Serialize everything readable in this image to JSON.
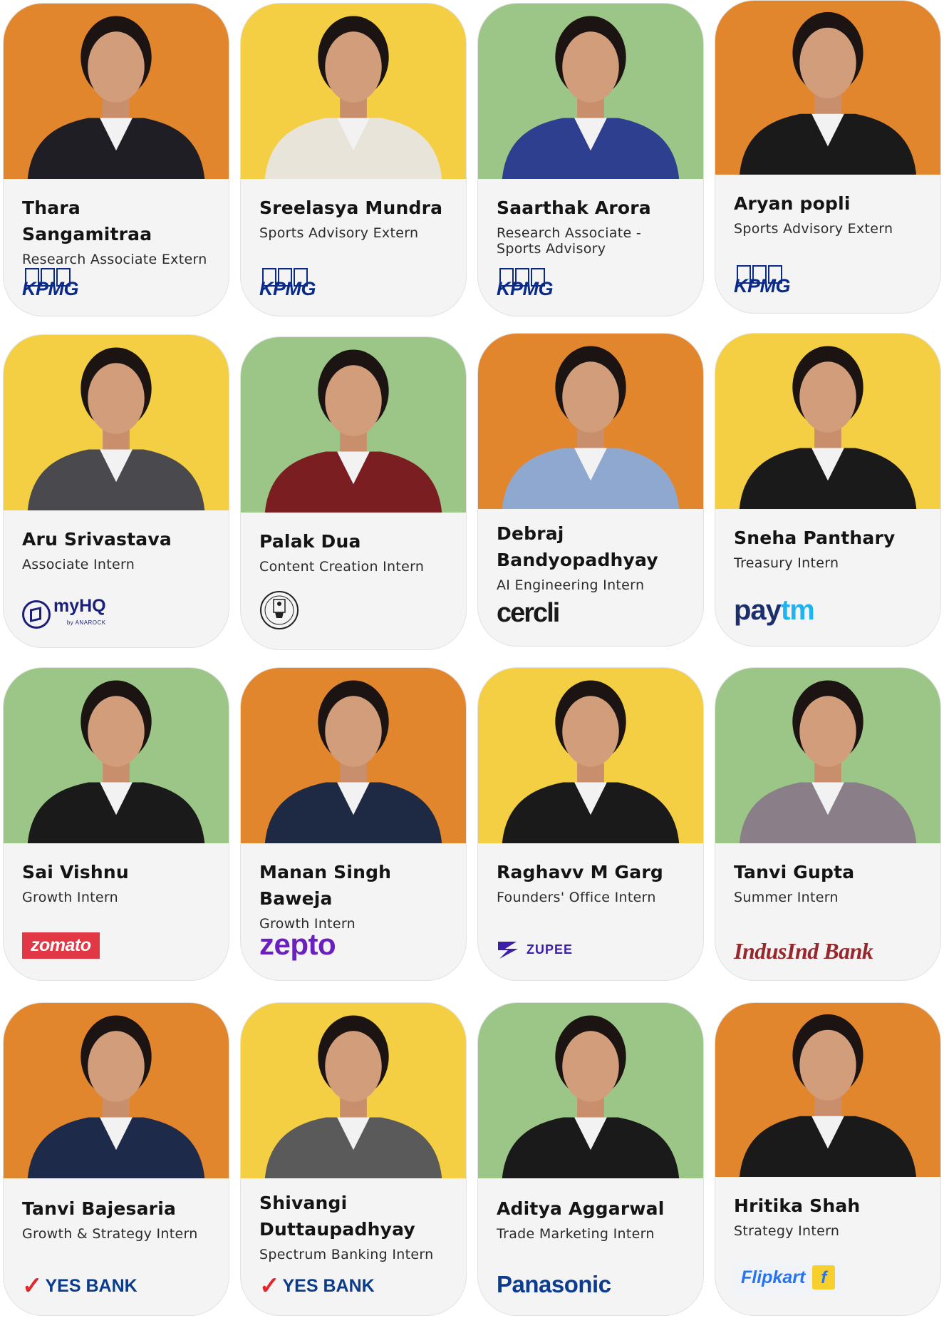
{
  "colors": {
    "orange": "#e2862e",
    "yellow": "#f4cf44",
    "green": "#9cc687",
    "card_bg": "#f4f4f4"
  },
  "cards": [
    {
      "name": "Thara Sangamitraa",
      "role": "Research Associate Extern",
      "company": "KPMG",
      "bg": "orange"
    },
    {
      "name": "Sreelasya Mundra",
      "role": "Sports Advisory Extern",
      "company": "KPMG",
      "bg": "yellow"
    },
    {
      "name": "Saarthak Arora",
      "role": "Research Associate - Sports Advisory",
      "company": "KPMG",
      "bg": "green"
    },
    {
      "name": "Aryan popli",
      "role": "Sports Advisory Extern",
      "company": "KPMG",
      "bg": "orange"
    },
    {
      "name": "Aru Srivastava",
      "role": "Associate Intern",
      "company": "myHQ",
      "company_sub": "by ANAROCK",
      "bg": "yellow"
    },
    {
      "name": "Palak Dua",
      "role": "Content Creation Intern",
      "company": "emblem-icon",
      "bg": "green"
    },
    {
      "name": "Debraj Bandyopadhyay",
      "role": "AI Engineering Intern",
      "company": "cercli",
      "bg": "orange"
    },
    {
      "name": "Sneha Panthary",
      "role": "Treasury Intern",
      "company_part1": "pay",
      "company_part2": "tm",
      "bg": "yellow"
    },
    {
      "name": "Sai Vishnu",
      "role": "Growth Intern",
      "company": "zomato",
      "bg": "green"
    },
    {
      "name": "Manan Singh Baweja",
      "role": "Growth Intern",
      "company": "zepto",
      "bg": "orange"
    },
    {
      "name": "Raghavv M Garg",
      "role": "Founders' Office Intern",
      "company": "ZUPEE",
      "bg": "yellow"
    },
    {
      "name": "Tanvi Gupta",
      "role": "Summer Intern",
      "company": "IndusInd Bank",
      "bg": "green"
    },
    {
      "name": "Tanvi Bajesaria",
      "role": "Growth & Strategy Intern",
      "company": "YES BANK",
      "bg": "orange"
    },
    {
      "name": "Shivangi Duttaupadhyay",
      "role": "Spectrum Banking Intern",
      "company": "YES BANK",
      "bg": "yellow"
    },
    {
      "name": "Aditya Aggarwal",
      "role": "Trade Marketing Intern",
      "company": "Panasonic",
      "bg": "green"
    },
    {
      "name": "Hritika Shah",
      "role": "Strategy Intern",
      "company": "Flipkart",
      "bg": "orange"
    }
  ]
}
